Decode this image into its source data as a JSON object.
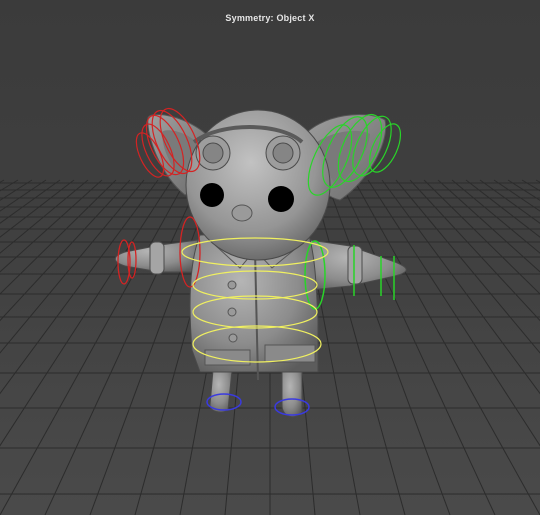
{
  "viewport": {
    "symmetry_label": "Symmetry: Object X"
  },
  "colors": {
    "background": "#3d3d3d",
    "grid_line": "#2a2a2a",
    "model_gray": "#8a8a8a",
    "control_left": "#d42323",
    "control_right": "#29d429",
    "control_center": "#f0f060",
    "control_feet": "#3a3ae0"
  },
  "scene": {
    "model": "eared-mouse-character-in-coat",
    "rig_controls": [
      "left-ear-control",
      "right-ear-control",
      "left-arm-control",
      "right-arm-control",
      "spine-controls",
      "left-foot-control",
      "right-foot-control"
    ]
  }
}
